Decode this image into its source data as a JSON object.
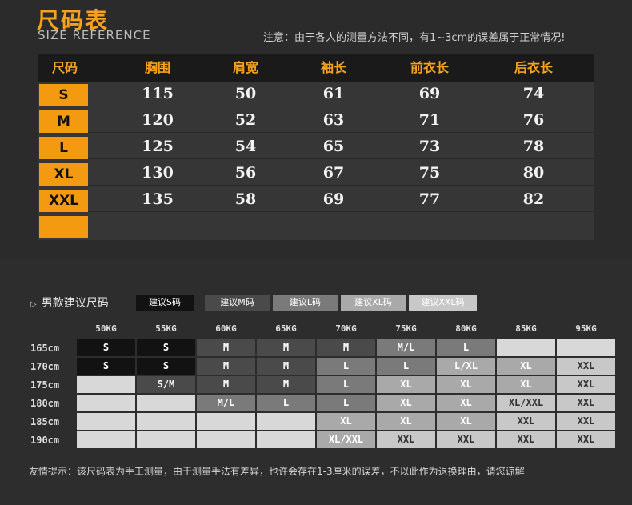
{
  "header": {
    "title_cn": "尺码表",
    "title_en": "SIZE REFERENCE",
    "note": "注意：由于各人的测量方法不同，有1~3cm的误差属于正常情况!"
  },
  "size_table": {
    "headers": [
      "尺码",
      "胸围",
      "肩宽",
      "袖长",
      "前衣长",
      "后衣长"
    ],
    "rows": [
      {
        "size": "S",
        "values": [
          "115",
          "50",
          "61",
          "69",
          "74"
        ]
      },
      {
        "size": "M",
        "values": [
          "120",
          "52",
          "63",
          "71",
          "76"
        ]
      },
      {
        "size": "L",
        "values": [
          "125",
          "54",
          "65",
          "73",
          "78"
        ]
      },
      {
        "size": "XL",
        "values": [
          "130",
          "56",
          "67",
          "75",
          "80"
        ]
      },
      {
        "size": "XXL",
        "values": [
          "135",
          "58",
          "69",
          "77",
          "82"
        ]
      },
      {
        "size": "",
        "values": [
          "",
          "",
          "",
          "",
          ""
        ]
      }
    ]
  },
  "recommend": {
    "title": "男款建议尺码",
    "legend": [
      {
        "label": "建议S码",
        "color": "#121212"
      },
      {
        "label": "建议M码",
        "color": "#4a4a4a"
      },
      {
        "label": "建议L码",
        "color": "#7a7a7a"
      },
      {
        "label": "建议XL码",
        "color": "#a9a9a9"
      },
      {
        "label": "建议XXL码",
        "color": "#c8c8c8"
      }
    ],
    "weights": [
      "50KG",
      "55KG",
      "60KG",
      "65KG",
      "70KG",
      "75KG",
      "80KG",
      "85KG",
      "95KG"
    ],
    "heights": [
      "165cm",
      "170cm",
      "175cm",
      "180cm",
      "185cm",
      "190cm"
    ],
    "grid": [
      [
        "S",
        "S",
        "M",
        "M",
        "M",
        "M/L",
        "L",
        "",
        ""
      ],
      [
        "S",
        "S",
        "M",
        "M",
        "L",
        "L",
        "L/XL",
        "XL",
        "XXL"
      ],
      [
        "",
        "S/M",
        "M",
        "M",
        "L",
        "XL",
        "XL",
        "XL",
        "XXL"
      ],
      [
        "",
        "",
        "M/L",
        "L",
        "L",
        "XL",
        "XL",
        "XL/XXL",
        "XXL"
      ],
      [
        "",
        "",
        "",
        "",
        "XL",
        "XL",
        "XL",
        "XXL",
        "XXL"
      ],
      [
        "",
        "",
        "",
        "",
        "XL/XXL",
        "XXL",
        "XXL",
        "XXL",
        "XXL"
      ]
    ]
  },
  "footer": {
    "note": "友情提示：该尺码表为手工测量，由于测量手法有差异，也许会存在1-3厘米的误差，不以此作为退换理由，请您谅解"
  }
}
